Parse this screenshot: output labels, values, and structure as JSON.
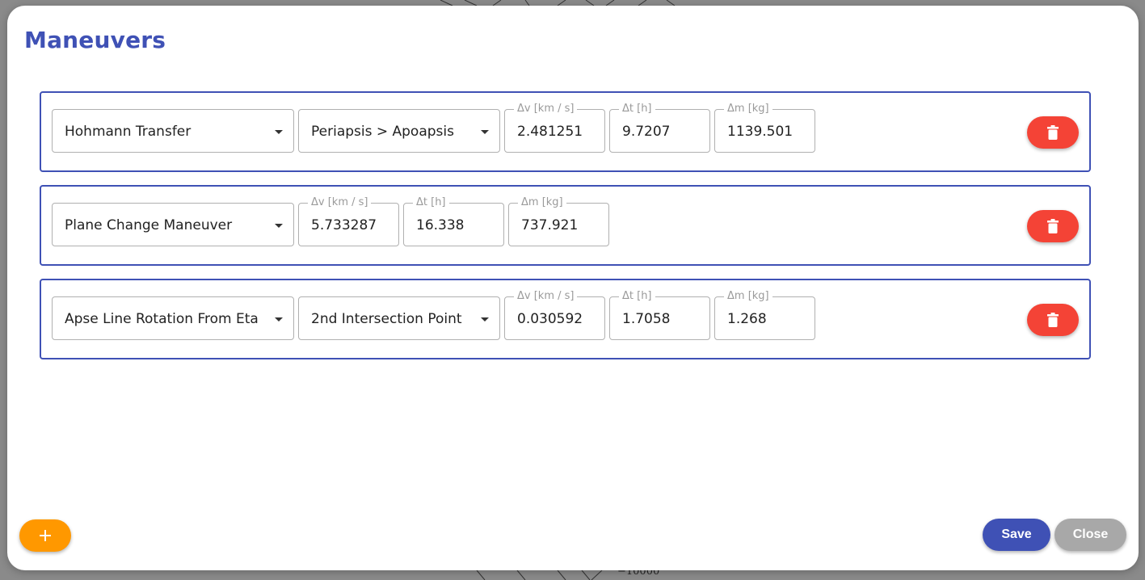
{
  "window": {
    "title": "Maneuvers"
  },
  "backdrop": {
    "axis_tick_label": "−10000"
  },
  "maneuvers": [
    {
      "type": "Hohmann Transfer",
      "option": "Periapsis > Apoapsis",
      "delta_v": {
        "label": "Δv [km / s]",
        "value": "2.481251"
      },
      "delta_t": {
        "label": "Δt [h]",
        "value": "9.7207"
      },
      "delta_m": {
        "label": "Δm [kg]",
        "value": "1139.501"
      }
    },
    {
      "type": "Plane Change Maneuver",
      "delta_v": {
        "label": "Δv [km / s]",
        "value": "5.733287"
      },
      "delta_t": {
        "label": "Δt [h]",
        "value": "16.338"
      },
      "delta_m": {
        "label": "Δm [kg]",
        "value": "737.921"
      }
    },
    {
      "type": "Apse Line Rotation From Eta",
      "option": "2nd Intersection Point",
      "delta_v": {
        "label": "Δv [km / s]",
        "value": "0.030592"
      },
      "delta_t": {
        "label": "Δt [h]",
        "value": "1.7058"
      },
      "delta_m": {
        "label": "Δm [kg]",
        "value": "1.268"
      }
    }
  ],
  "footer": {
    "save_label": "Save",
    "close_label": "Close"
  },
  "icons": {
    "delete": "trash-icon",
    "add": "plus-icon"
  },
  "colors": {
    "accent": "#3f51b5",
    "danger": "#f44336",
    "add": "#ff9800",
    "close": "#a8a8a8"
  }
}
